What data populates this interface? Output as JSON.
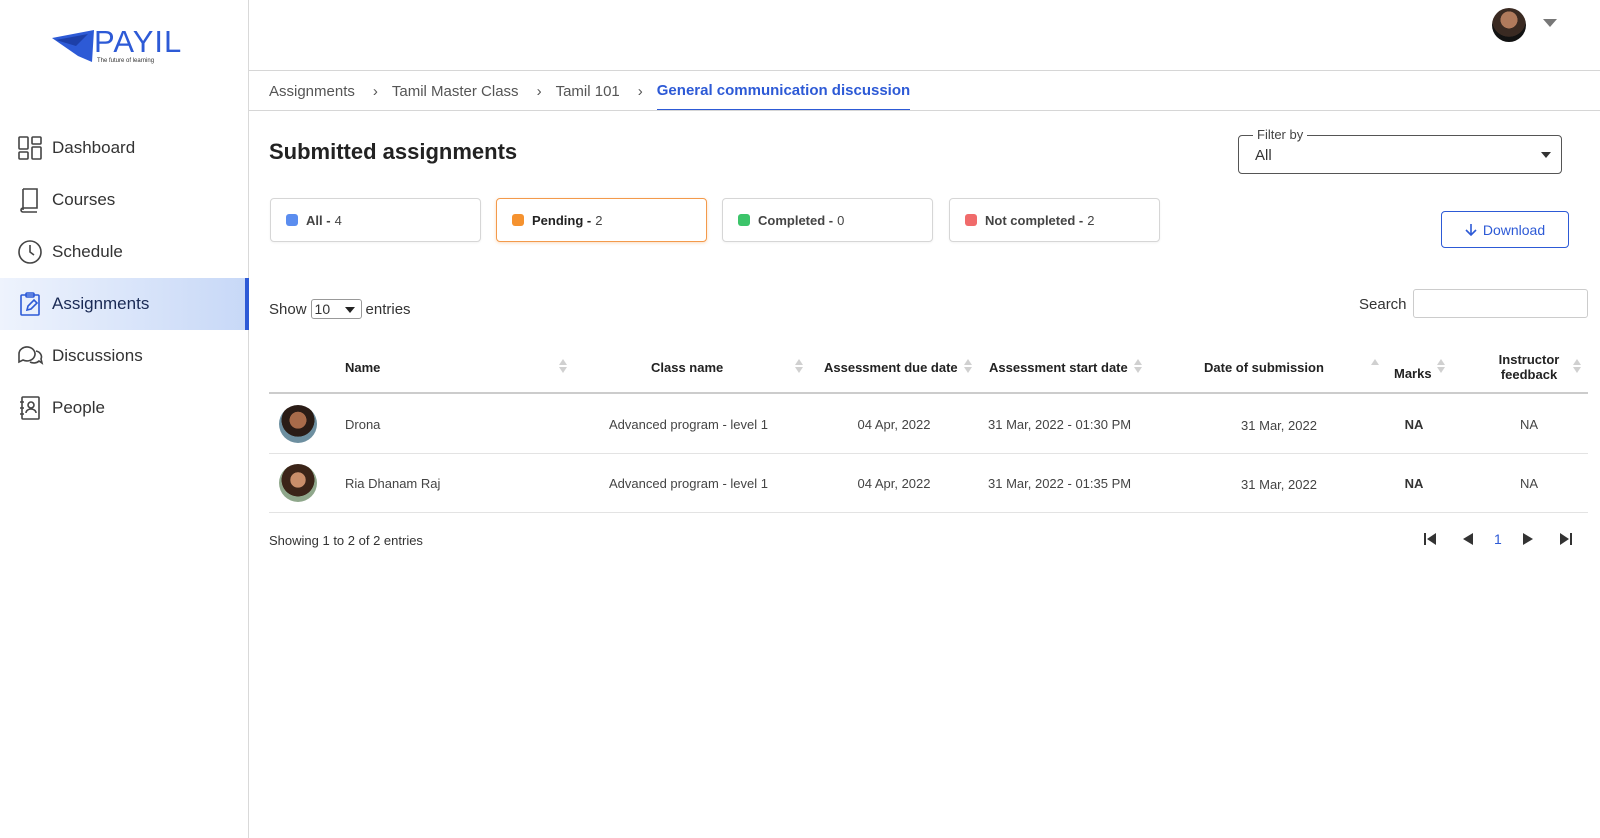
{
  "app": {
    "logo_text": "PAYIL",
    "logo_tagline": "The future of learning"
  },
  "sidebar": {
    "items": [
      {
        "label": "Dashboard",
        "icon": "dashboard-icon",
        "active": false
      },
      {
        "label": "Courses",
        "icon": "book-icon",
        "active": false
      },
      {
        "label": "Schedule",
        "icon": "clock-icon",
        "active": false
      },
      {
        "label": "Assignments",
        "icon": "clipboard-edit-icon",
        "active": true
      },
      {
        "label": "Discussions",
        "icon": "chat-bubbles-icon",
        "active": false
      },
      {
        "label": "People",
        "icon": "contacts-book-icon",
        "active": false
      }
    ]
  },
  "breadcrumb": {
    "items": [
      "Assignments",
      "Tamil Master Class",
      "Tamil 101",
      "General communication discussion"
    ]
  },
  "page": {
    "title": "Submitted assignments"
  },
  "filter": {
    "label": "Filter by",
    "value": "All"
  },
  "status_cards": [
    {
      "label": "All - ",
      "count": "4",
      "color": "#5b8def",
      "selected": false
    },
    {
      "label": "Pending - ",
      "count": "2",
      "color": "#f5922f",
      "selected": true
    },
    {
      "label": "Completed - ",
      "count": "0",
      "color": "#3cc46a",
      "selected": false
    },
    {
      "label": "Not completed - ",
      "count": "2",
      "color": "#f06b6b",
      "selected": false
    }
  ],
  "download": {
    "label": "Download"
  },
  "entries": {
    "show_label": "Show",
    "value": "10",
    "entries_label": "entries",
    "search_label": "Search",
    "search_value": ""
  },
  "table": {
    "columns": [
      "Name",
      "Class name",
      "Assessment due date",
      "Assessment start date",
      "Date of submission",
      "Marks",
      "Instructor feedback"
    ],
    "rows": [
      {
        "name": "Drona",
        "class_name": "Advanced program - level 1",
        "due_date": "04 Apr, 2022",
        "start_date": "31 Mar, 2022 - 01:30 PM",
        "submission_date": "31 Mar, 2022",
        "marks": "NA",
        "feedback": "NA"
      },
      {
        "name": "Ria Dhanam Raj",
        "class_name": "Advanced program - level 1",
        "due_date": "04 Apr, 2022",
        "start_date": "31 Mar, 2022 - 01:35 PM",
        "submission_date": "31 Mar, 2022",
        "marks": "NA",
        "feedback": "NA"
      }
    ]
  },
  "footer": {
    "showing_text": "Showing 1 to 2 of 2 entries",
    "current_page": "1"
  },
  "colors": {
    "accent": "#2d5ad6",
    "active_nav_bg": "#c7d8f7"
  }
}
